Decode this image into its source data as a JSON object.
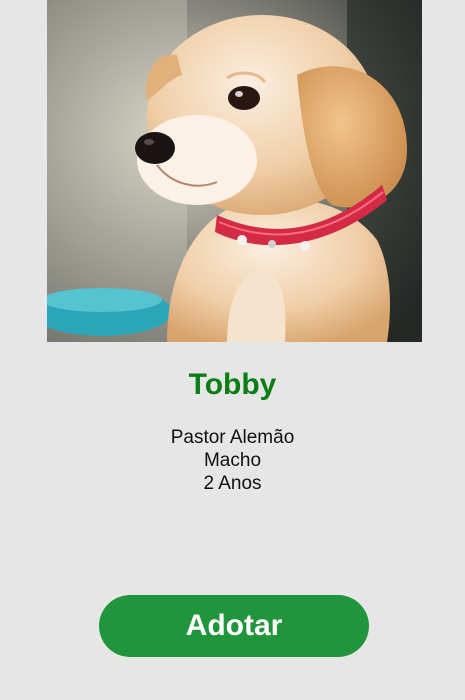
{
  "pet": {
    "photo_icon": "puppy-photo",
    "name": "Tobby",
    "breed": "Pastor Alemão",
    "sex": "Macho",
    "age": "2 Anos"
  },
  "actions": {
    "adopt_label": "Adotar"
  },
  "colors": {
    "background": "#e6e6e6",
    "name_green": "#0a7d16",
    "button_green": "#20953b"
  }
}
